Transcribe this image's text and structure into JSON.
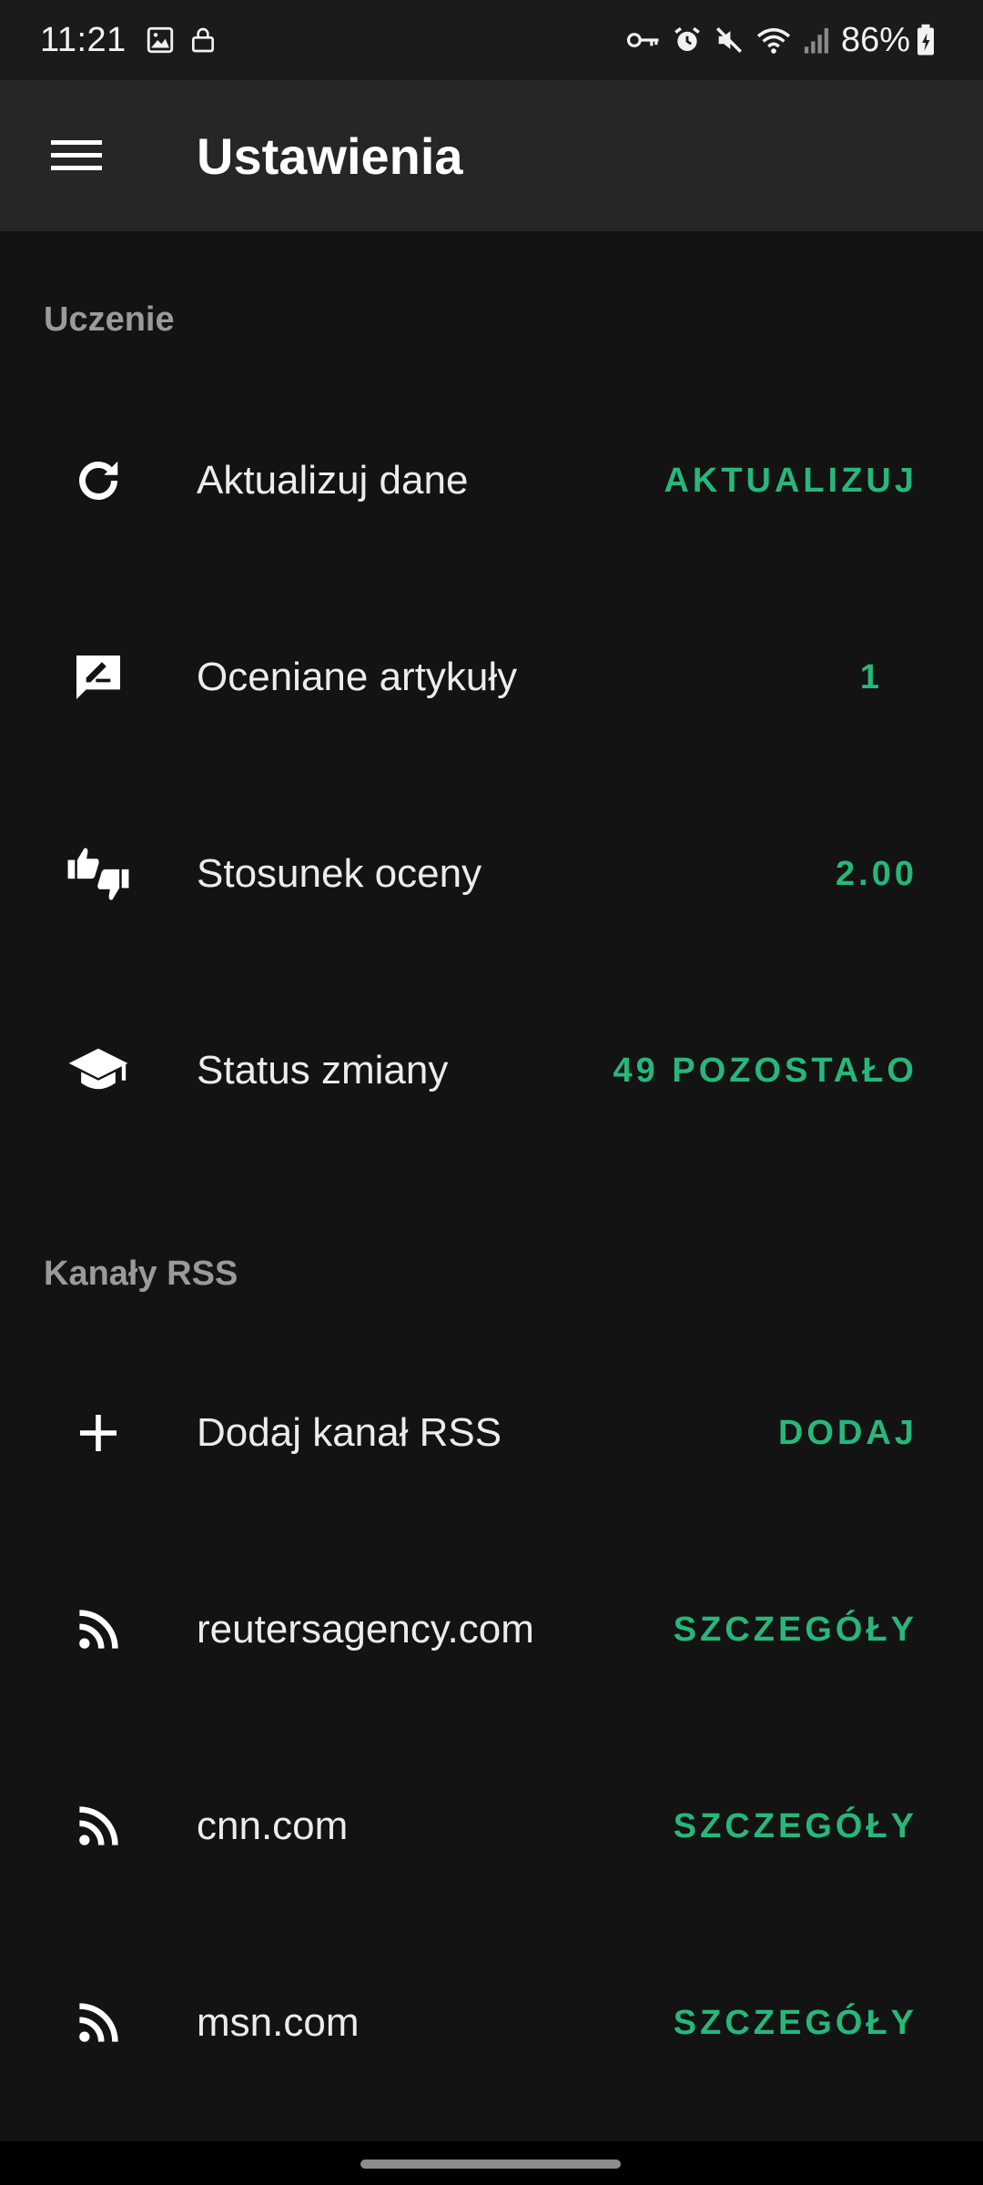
{
  "status_bar": {
    "time": "11:21",
    "battery": "86%",
    "icons_left": [
      "image-icon",
      "lock-icon"
    ],
    "icons_right": [
      "key-icon",
      "alarm-icon",
      "mute-icon",
      "wifi-icon",
      "signal-icon",
      "battery-icon"
    ]
  },
  "app_bar": {
    "title": "Ustawienia",
    "menu_icon": "hamburger-menu-icon"
  },
  "sections": {
    "learning": {
      "header": "Uczenie",
      "rows": [
        {
          "icon": "refresh-icon",
          "label": "Aktualizuj dane",
          "action": "AKTUALIZUJ"
        },
        {
          "icon": "rate-review-icon",
          "label": "Oceniane artykuły",
          "action": "1"
        },
        {
          "icon": "thumbs-up-down-icon",
          "label": "Stosunek oceny",
          "action": "2.00"
        },
        {
          "icon": "graduation-cap-icon",
          "label": "Status zmiany",
          "action": "49 POZOSTAŁO"
        }
      ]
    },
    "rss": {
      "header": "Kanały RSS",
      "rows": [
        {
          "icon": "add-icon",
          "label": "Dodaj kanał RSS",
          "action": "DODAJ"
        },
        {
          "icon": "rss-icon",
          "label": "reutersagency.com",
          "action": "SZCZEGÓŁY"
        },
        {
          "icon": "rss-icon",
          "label": "cnn.com",
          "action": "SZCZEGÓŁY"
        },
        {
          "icon": "rss-icon",
          "label": "msn.com",
          "action": "SZCZEGÓŁY"
        }
      ]
    }
  },
  "colors": {
    "accent": "#27b77a",
    "background": "#131313",
    "app_bar": "#262626",
    "section_header": "#9a9a9a"
  }
}
